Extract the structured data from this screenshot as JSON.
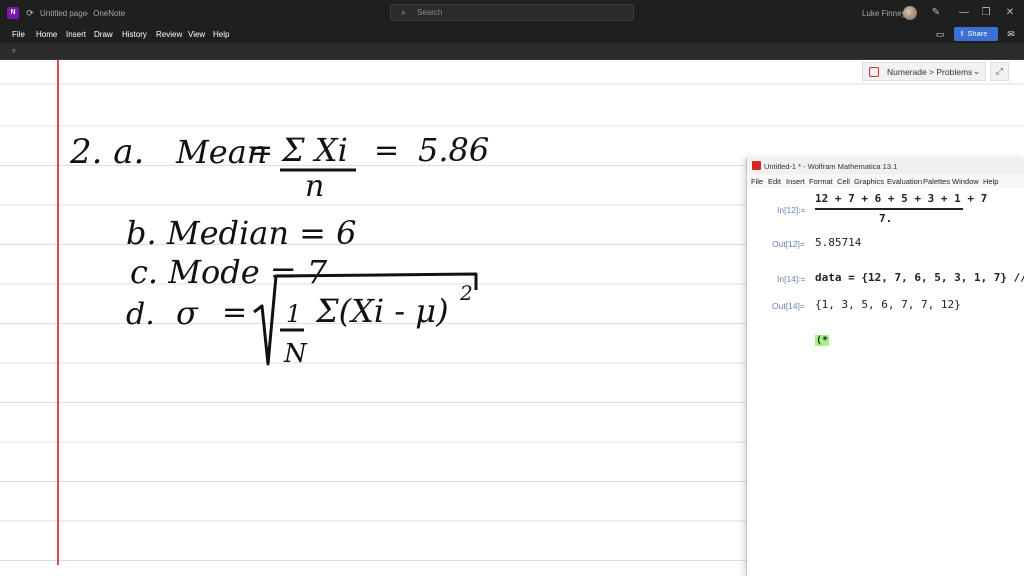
{
  "titlebar": {
    "doc_title": "Untitled page",
    "separator": "-",
    "app_name": "OneNote",
    "search_placeholder": "Search",
    "user_name": "Luke Finney"
  },
  "menu": {
    "items": [
      "File",
      "Home",
      "Insert",
      "Draw",
      "History",
      "Review",
      "View",
      "Help"
    ],
    "share_label": "Share"
  },
  "numerade": {
    "breadcrumb": "Numerade > Problems"
  },
  "mathematica": {
    "window_title": "Untitled-1 * - Wolfram Mathematica 13.1",
    "menu": [
      "File",
      "Edit",
      "Insert",
      "Format",
      "Cell",
      "Graphics",
      "Evaluation",
      "Palettes",
      "Window",
      "Help"
    ],
    "cells": [
      {
        "in_label": "In[12]:=",
        "numerator": "12 + 7 + 6 + 5 + 3 + 1 + 7",
        "denominator": "7.",
        "out_label": "Out[12]=",
        "output": "5.85714"
      },
      {
        "in_label": "In[14]:=",
        "input": "data = {12, 7, 6, 5, 3, 1, 7} //",
        "out_label": "Out[14]=",
        "output": "{1, 3, 5, 6, 7, 7, 12}"
      }
    ],
    "comment": "(*"
  },
  "notes": {
    "line1_label": "2. a.",
    "mean_word": "Mean",
    "eq1": "=",
    "sigma_xi": "Σ Xi",
    "n": "n",
    "eq2": "=",
    "mean_value": "5.86",
    "line2": "b. Median = 6",
    "line3": "c. Mode = 7",
    "line4_label": "d.",
    "sigma_symbol": "σ",
    "eq3": "=",
    "one": "1",
    "N": "N",
    "sum_expr": "Σ(Xi - μ)",
    "sq": "2"
  }
}
